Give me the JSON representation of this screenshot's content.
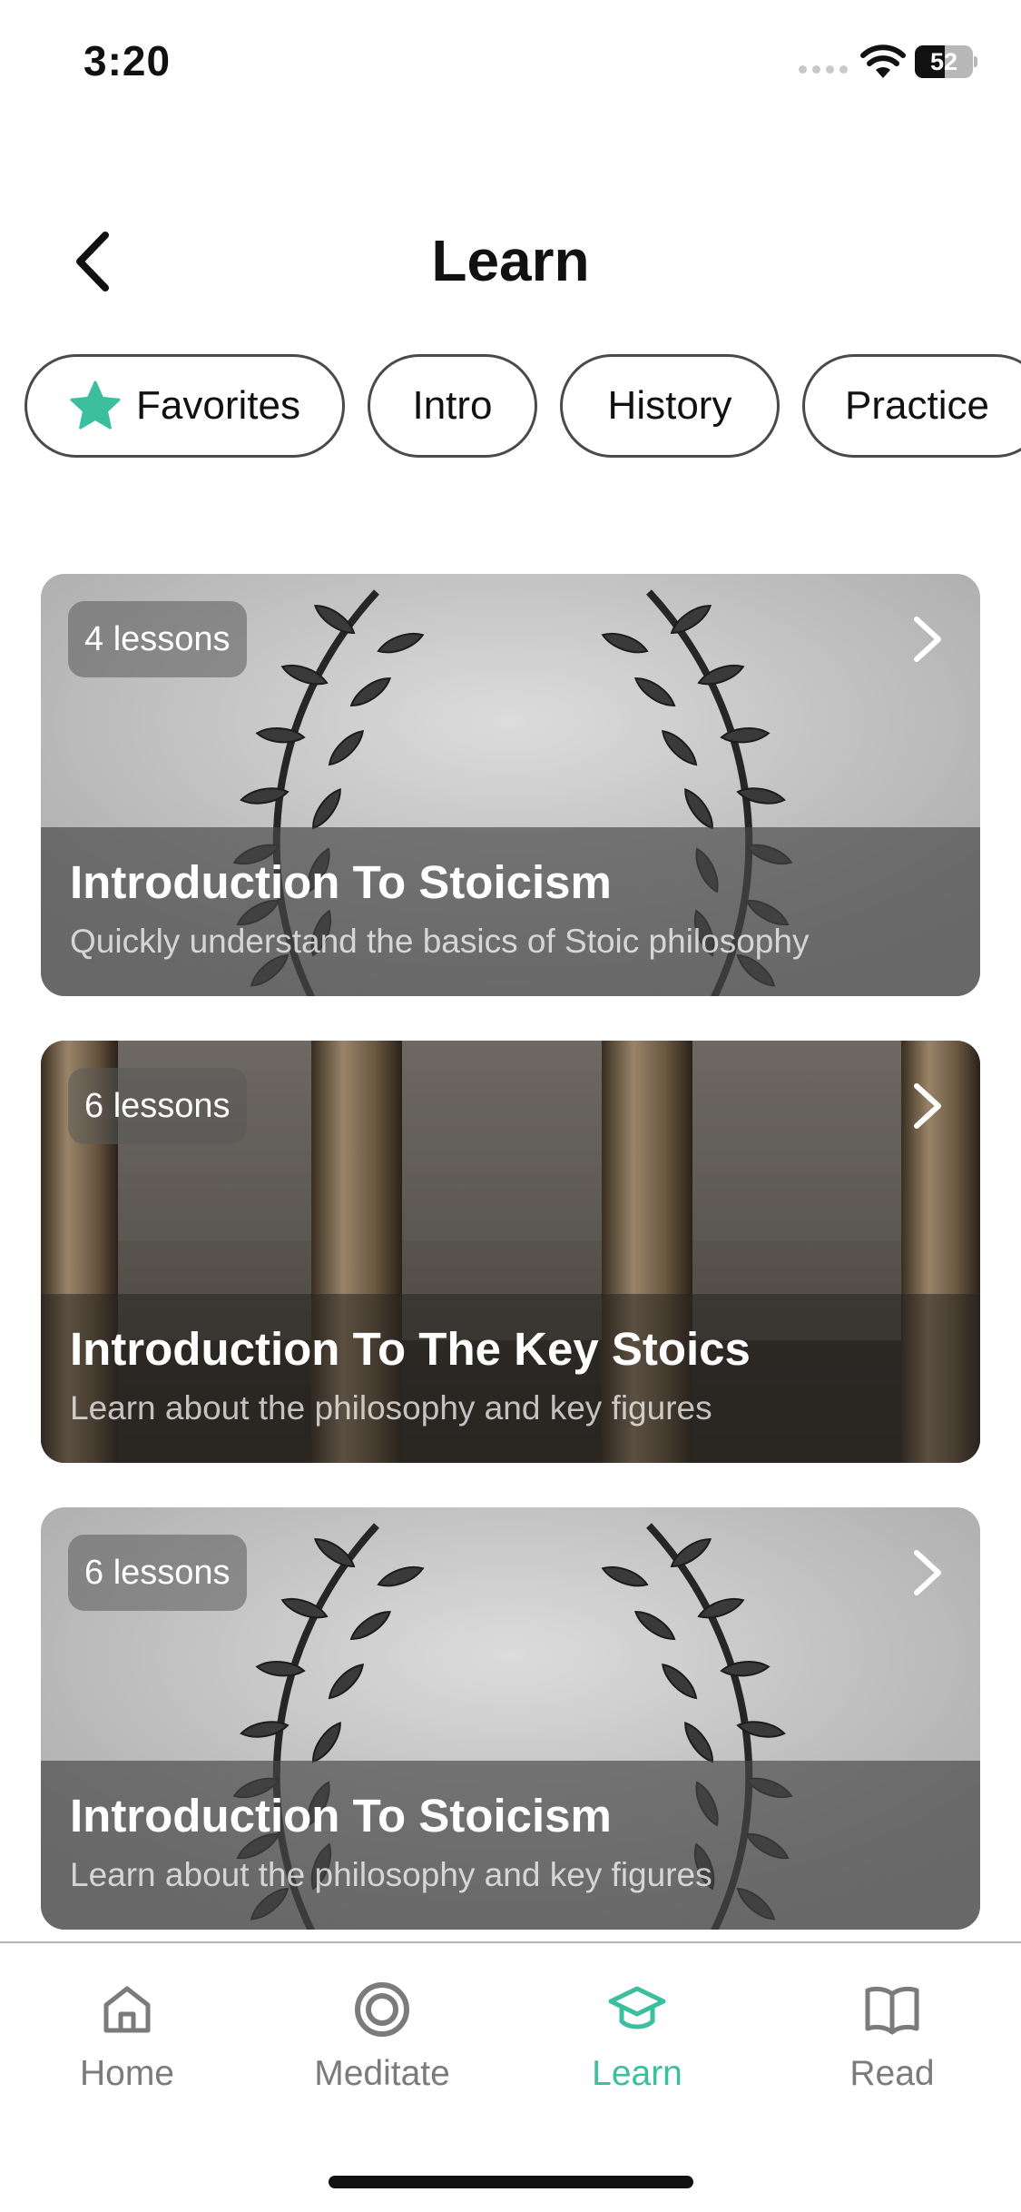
{
  "status_bar": {
    "time": "3:20",
    "battery": "52",
    "battery_level": 0.52
  },
  "header": {
    "back_icon": "chevron-left-icon",
    "title": "Learn"
  },
  "filters": [
    {
      "label": "Favorites",
      "icon": "star-icon"
    },
    {
      "label": "Intro"
    },
    {
      "label": "History"
    },
    {
      "label": "Practice"
    }
  ],
  "colors": {
    "accent": "#3bbf9f",
    "inactive": "#7b7b7b"
  },
  "cards": [
    {
      "badge": "4 lessons",
      "title": "Introduction To Stoicism",
      "subtitle": "Quickly understand the basics of Stoic philosophy",
      "image": "laurel-wreath"
    },
    {
      "badge": "6 lessons",
      "title": "Introduction To The Key Stoics",
      "subtitle": "Learn about the philosophy and key figures",
      "image": "columns"
    },
    {
      "badge": "6 lessons",
      "title": "Introduction To Stoicism",
      "subtitle": "Learn about the philosophy and key figures",
      "image": "laurel-wreath"
    }
  ],
  "tab_bar": {
    "active": "Learn",
    "tabs": [
      {
        "label": "Home",
        "icon": "home-icon"
      },
      {
        "label": "Meditate",
        "icon": "target-icon"
      },
      {
        "label": "Learn",
        "icon": "graduation-cap-icon"
      },
      {
        "label": "Read",
        "icon": "book-icon"
      }
    ]
  }
}
